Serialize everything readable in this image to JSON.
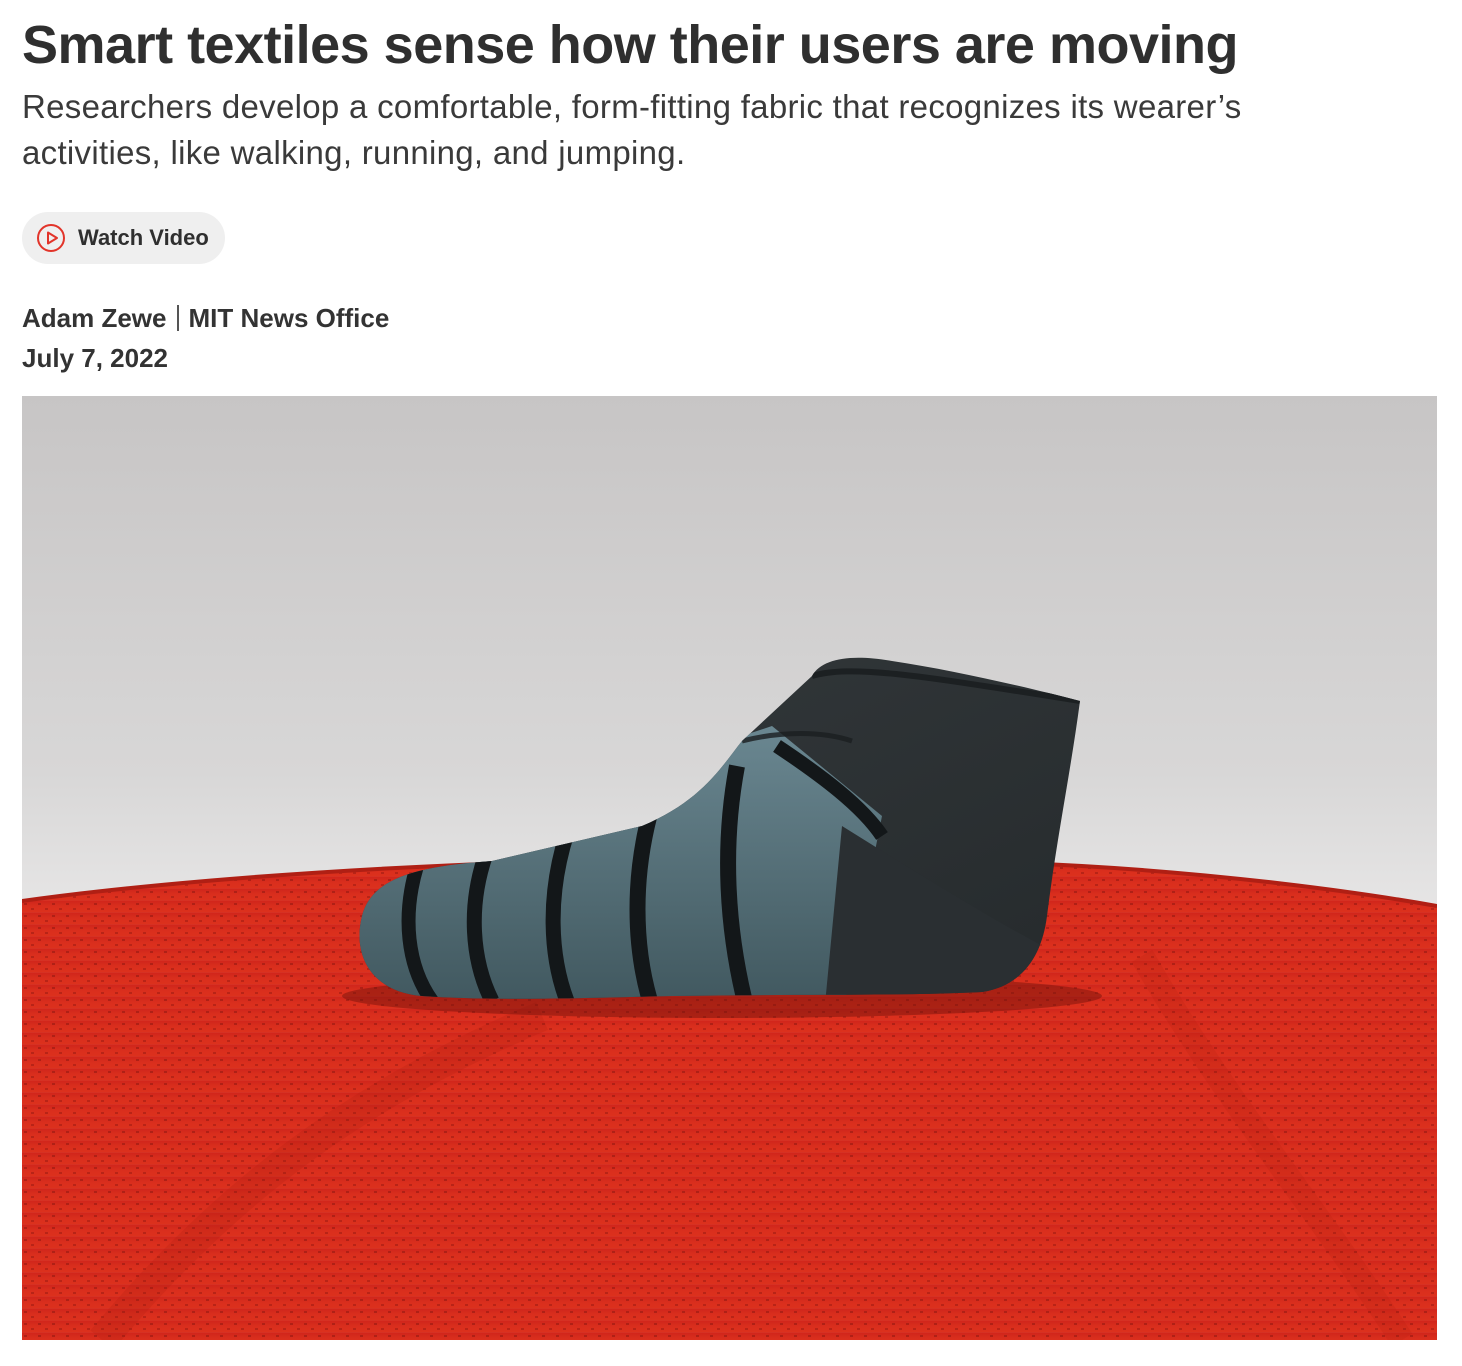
{
  "article": {
    "headline": "Smart textiles sense how their users are moving",
    "dek": "Researchers develop a comfortable, form-fitting fabric that recognizes its wearer’s activities, like walking, running, and jumping.",
    "video_button": {
      "label": "Watch Video",
      "icon": "play-circle-icon"
    },
    "author": "Adam Zewe",
    "source": "MIT News Office",
    "date": "July 7, 2022"
  },
  "hero_image": {
    "subject": "knitted sock on red textile",
    "colors": {
      "fabric_red": "#d8281c",
      "sock_dark": "#2b3033",
      "sock_teal": "#4f6a72",
      "stripe_black": "#14181a",
      "background_gray": "#d4d3d3"
    }
  },
  "theme": {
    "accent": "#e2342a",
    "button_bg": "#efefef",
    "text": "#2f2f2f"
  }
}
